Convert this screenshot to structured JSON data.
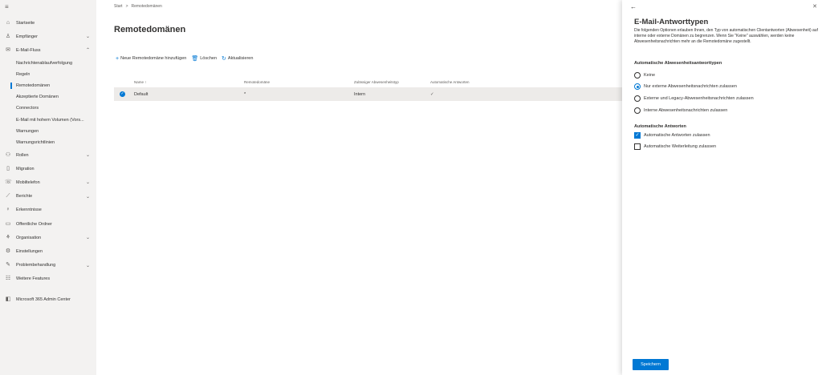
{
  "colors": {
    "accent": "#0078d4",
    "sidebar_bg": "#f3f2f1",
    "selected_row": "#edebe9"
  },
  "sidebar": {
    "items": [
      {
        "icon": "home-icon",
        "glyph": "⌂",
        "label": "Startseite",
        "chevron": ""
      },
      {
        "icon": "person-icon",
        "glyph": "♙",
        "label": "Empfänger",
        "chevron": "⌄"
      },
      {
        "icon": "mail-icon",
        "glyph": "✉",
        "label": "E-Mail-Fluss",
        "chevron": "⌃"
      }
    ],
    "subitems": [
      {
        "label": "Nachrichtenablaufverfolgung"
      },
      {
        "label": "Regeln"
      },
      {
        "label": "Remotedomänen"
      },
      {
        "label": "Akzeptierte Domänen"
      },
      {
        "label": "Connectors"
      },
      {
        "label": "E-Mail mit hohem Volumen (Vors..."
      },
      {
        "label": "Warnungen"
      },
      {
        "label": "Warnungsrichtlinien"
      }
    ],
    "items2": [
      {
        "icon": "roles-icon",
        "glyph": "⚇",
        "label": "Rollen",
        "chevron": "⌄"
      },
      {
        "icon": "migration-icon",
        "glyph": "▯",
        "label": "Migration",
        "chevron": ""
      },
      {
        "icon": "mobile-icon",
        "glyph": "☏",
        "label": "Mobiltelefon",
        "chevron": "⌄"
      },
      {
        "icon": "reports-icon",
        "glyph": "⟋",
        "label": "Berichte",
        "chevron": "⌄"
      },
      {
        "icon": "insights-icon",
        "glyph": "♀",
        "label": "Erkenntnisse",
        "chevron": ""
      },
      {
        "icon": "public-folder-icon",
        "glyph": "▭",
        "label": "Öffentliche Ordner",
        "chevron": ""
      },
      {
        "icon": "organization-icon",
        "glyph": "⚘",
        "label": "Organisation",
        "chevron": "⌄"
      },
      {
        "icon": "settings-icon",
        "glyph": "⚙",
        "label": "Einstellungen",
        "chevron": ""
      },
      {
        "icon": "troubleshoot-icon",
        "glyph": "✎",
        "label": "Problembehandlung",
        "chevron": "⌄"
      },
      {
        "icon": "more-features-icon",
        "glyph": "☷",
        "label": "Weitere Features",
        "chevron": ""
      }
    ],
    "admin_center": {
      "icon": "office-icon",
      "glyph": "◧",
      "label": "Microsoft 365 Admin Center"
    }
  },
  "breadcrumb": {
    "home": "Start",
    "separator": ">",
    "current": "Remotedomänen"
  },
  "page_title": "Remotedomänen",
  "toolbar": {
    "add": "Neue Remotedomäne hinzufügen",
    "delete": "Löschen",
    "refresh": "Aktualisieren"
  },
  "table": {
    "headers": [
      "Name ↑",
      "Remotedomäne",
      "Zulässiger Abwesenheitstyp",
      "Automatische Antworten"
    ],
    "rows": [
      {
        "name": "Default",
        "domain": "*",
        "type": "Intern",
        "auto": "✓"
      }
    ]
  },
  "panel": {
    "title": "E-Mail-Antworttypen",
    "description": "Die folgenden Optionen erlauben Ihnen, den Typ von automatischen Clientantworten (Abwesenheit) auf interne oder externe Domänen zu begrenzen. Wenn Sie \"Keine\" auswählen, werden keine Abwesenheitsnachrichten mehr an die Remotedomäne zugestellt.",
    "section1": "Automatische Abwesenheitsantworttypen",
    "radios": [
      {
        "label": "Keine",
        "checked": false
      },
      {
        "label": "Nur externe Abwesenheitsnachrichten zulassen",
        "checked": true
      },
      {
        "label": "Externe und Legacy-Abwesenheitsnachrichten zulassen",
        "checked": false
      },
      {
        "label": "Interne Abwesenheitsnachrichten zulassen",
        "checked": false
      }
    ],
    "section2": "Automatische Antworten",
    "checkboxes": [
      {
        "label": "Automatische Antworten zulassen",
        "checked": true
      },
      {
        "label": "Automatische Weiterleitung zulassen",
        "checked": false
      }
    ],
    "save": "Speichern"
  }
}
